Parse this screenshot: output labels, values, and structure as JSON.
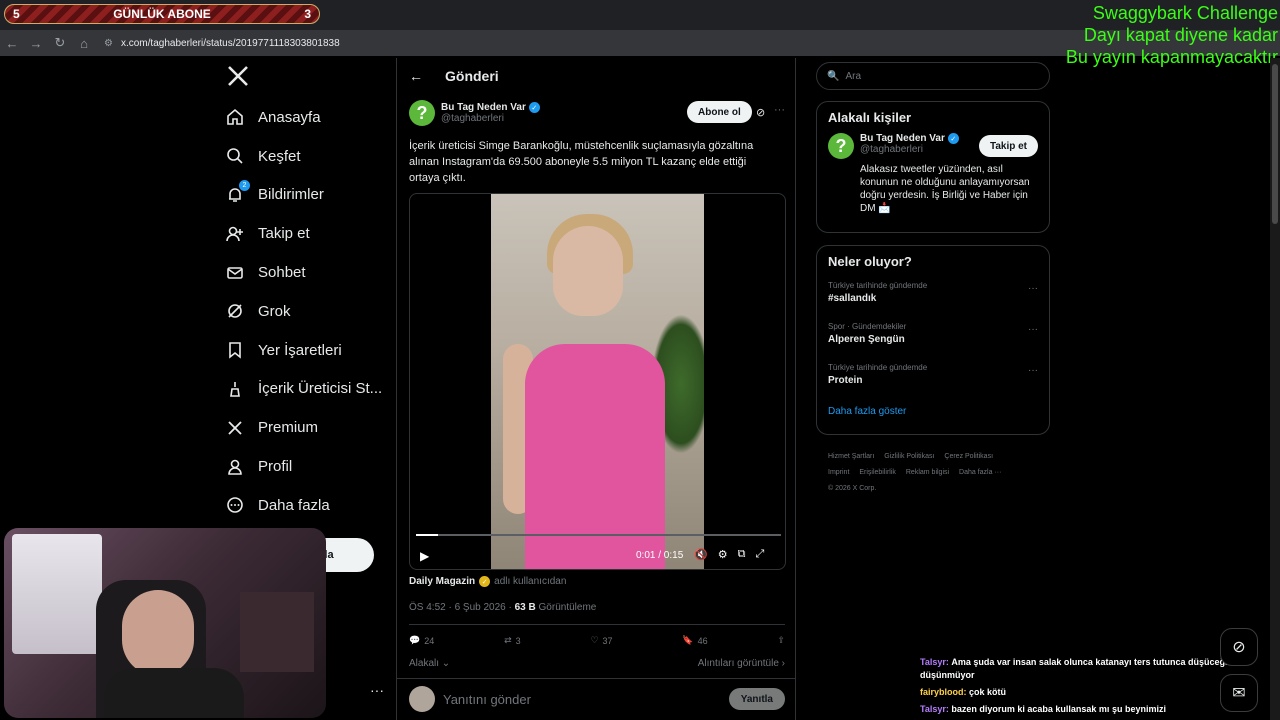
{
  "subscriber_bar": {
    "left_value": "5",
    "label": "GÜNLÜK ABONE",
    "right_value": "3"
  },
  "browser": {
    "url": "x.com/taghaberleri/status/2019771118303801838"
  },
  "stream_overlay": {
    "line1": "Swaggybark Challenge",
    "line2": "Dayı kapat diyene kadar",
    "line3": "Bu yayın kapanmayacaktır"
  },
  "nav": {
    "items": [
      {
        "label": "Anasayfa",
        "icon": "home-icon"
      },
      {
        "label": "Keşfet",
        "icon": "search-icon"
      },
      {
        "label": "Bildirimler",
        "icon": "bell-icon",
        "badge": "2"
      },
      {
        "label": "Takip et",
        "icon": "add-person-icon"
      },
      {
        "label": "Sohbet",
        "icon": "mail-icon"
      },
      {
        "label": "Grok",
        "icon": "grok-icon"
      },
      {
        "label": "Yer İşaretleri",
        "icon": "bookmark-icon"
      },
      {
        "label": "İçerik Üreticisi St...",
        "icon": "creator-icon"
      },
      {
        "label": "Premium",
        "icon": "x-icon"
      },
      {
        "label": "Profil",
        "icon": "person-icon"
      },
      {
        "label": "Daha fazla",
        "icon": "more-circle-icon"
      }
    ],
    "post_label": "la",
    "more_dots": "···"
  },
  "post": {
    "header_title": "Gönderi",
    "author_name": "Bu Tag Neden Var",
    "author_handle": "@taghaberleri",
    "subscribe_label": "Abone ol",
    "text": "İçerik üreticisi Simge Barankoğlu, müstehcenlik suçlamasıyla gözaltına alınan Instagram'da 69.500 aboneyle 5.5 milyon TL kazanç elde ettiği ortaya çıktı.",
    "video": {
      "time": "0:01 / 0:15",
      "progress": 0.06
    },
    "credit_name": "Daily Magazin",
    "credit_suffix": "adlı kullanıcıdan",
    "meta_time": "ÖS 4:52 · 6 Şub 2026 · ",
    "meta_views_count": "63 B",
    "meta_views_label": " Görüntüleme",
    "actions": {
      "replies": "24",
      "reposts": "3",
      "likes": "37",
      "bookmarks": "46"
    },
    "relevant_label": "Alakalı",
    "quotes_label": "Alıntıları görüntüle",
    "reply_placeholder": "Yanıtını gönder",
    "reply_button": "Yanıtla"
  },
  "right": {
    "search_placeholder": "Ara",
    "related_title": "Alakalı kişiler",
    "related_person": {
      "name": "Bu Tag Neden Var",
      "handle": "@taghaberleri",
      "follow_label": "Takip et",
      "bio": "Alakasız tweetler yüzünden, asıl konunun ne olduğunu anlayamıyorsan doğru yerdesin. İş Birliği ve Haber için DM 📩"
    },
    "trends_title": "Neler oluyor?",
    "trends": [
      {
        "context": "Türkiye tarihinde gündemde",
        "topic": "#sallandık"
      },
      {
        "context": "Spor · Gündemdekiler",
        "topic": "Alperen Şengün"
      },
      {
        "context": "Türkiye tarihinde gündemde",
        "topic": "Protein"
      }
    ],
    "show_more": "Daha fazla göster",
    "footer": [
      "Hizmet Şartları",
      "Gizlilik Politikası",
      "Çerez Politikası",
      "Imprint",
      "Erişilebilirlik",
      "Reklam bilgisi",
      "Daha fazla ···",
      "© 2026 X Corp."
    ]
  },
  "chat": [
    {
      "user": "Talsyr:",
      "message": "Ama şuda var insan salak olunca katanayı ters tutunca düşüceğinide düşünmüyor"
    },
    {
      "user": "fairyblood:",
      "message": "çok kötü"
    },
    {
      "user": "Talsyr:",
      "message": "bazen diyorum ki acaba kullansak mı şu beynimizi"
    }
  ]
}
